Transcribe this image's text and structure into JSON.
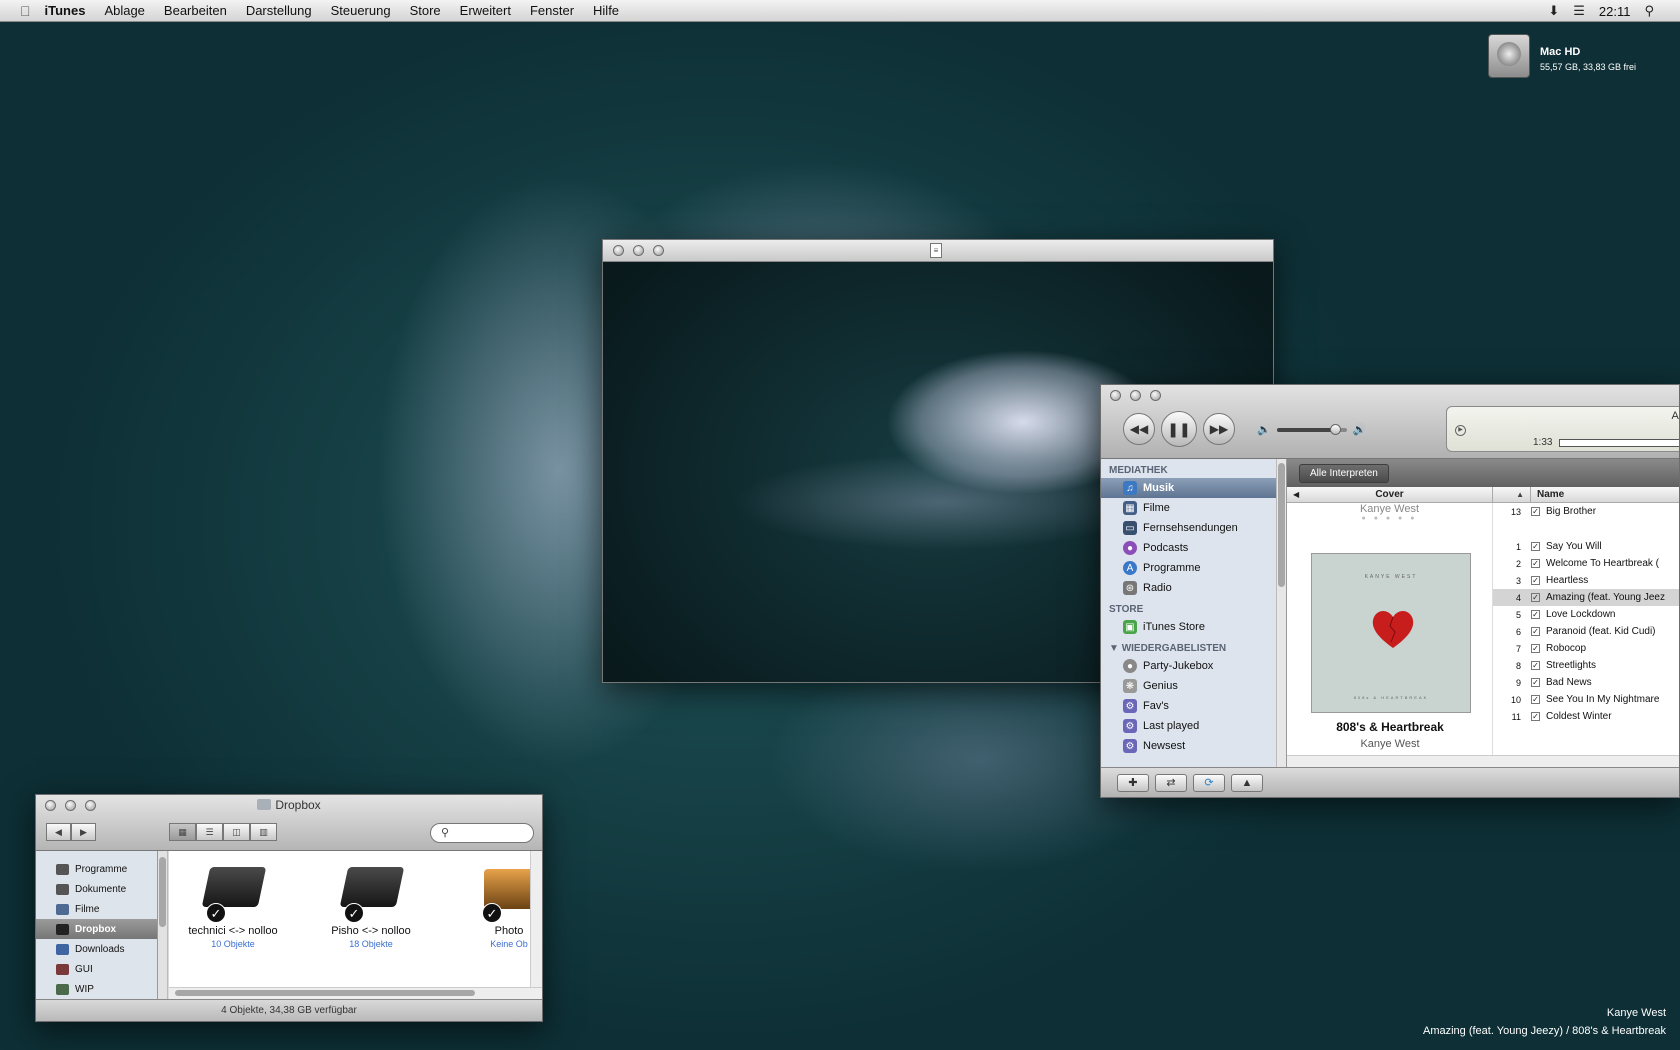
{
  "menubar": {
    "app": "iTunes",
    "items": [
      "Ablage",
      "Bearbeiten",
      "Darstellung",
      "Steuerung",
      "Store",
      "Erweitert",
      "Fenster",
      "Hilfe"
    ],
    "clock": "22:11"
  },
  "desktop": {
    "disk_name": "Mac HD",
    "disk_info": "55,57 GB, 33,83 GB frei",
    "nowplaying_artist": "Kanye West",
    "nowplaying_track": "Amazing (feat. Young Jeezy) / 808's & Heartbreak"
  },
  "itunes": {
    "lcd_title": "An",
    "lcd_time": "1:33",
    "volume_level": 0.85,
    "sidebar": {
      "library_head": "MEDIATHEK",
      "library": [
        "Musik",
        "Filme",
        "Fernsehsendungen",
        "Podcasts",
        "Programme",
        "Radio"
      ],
      "store_head": "STORE",
      "store": [
        "iTunes Store"
      ],
      "playlists_head": "WIEDERGABELISTEN",
      "playlists": [
        "Party-Jukebox",
        "Genius",
        "Fav's",
        "Last played",
        "Newsest"
      ]
    },
    "crumb": "Alle Interpreten",
    "columns": {
      "cover": "Cover",
      "name": "Name"
    },
    "prev_artist": "Kanye West",
    "prev_track": {
      "num": "13",
      "name": "Big Brother"
    },
    "album_title": "808's & Heartbreak",
    "album_artist": "Kanye West",
    "cover_art_top": "KANYE WEST",
    "cover_art_bottom": "808s & HEARTBREAK",
    "tracks": [
      {
        "num": "1",
        "name": "Say You Will"
      },
      {
        "num": "2",
        "name": "Welcome To Heartbreak ("
      },
      {
        "num": "3",
        "name": "Heartless"
      },
      {
        "num": "4",
        "name": "Amazing (feat. Young Jeez"
      },
      {
        "num": "5",
        "name": "Love Lockdown"
      },
      {
        "num": "6",
        "name": "Paranoid (feat. Kid Cudi)"
      },
      {
        "num": "7",
        "name": "Robocop"
      },
      {
        "num": "8",
        "name": "Streetlights"
      },
      {
        "num": "9",
        "name": "Bad News"
      },
      {
        "num": "10",
        "name": "See You In My Nightmare"
      },
      {
        "num": "11",
        "name": "Coldest Winter"
      }
    ]
  },
  "finder": {
    "title": "Dropbox",
    "sidebar": [
      "Programme",
      "Dokumente",
      "Filme",
      "Dropbox",
      "Downloads",
      "GUI",
      "WIP"
    ],
    "files": [
      {
        "name": "technici <-> nolloo",
        "sub": "10 Objekte"
      },
      {
        "name": "Pisho <-> nolloo",
        "sub": "18 Objekte"
      },
      {
        "name": "Photo",
        "sub": "Keine Ob"
      }
    ],
    "status": "4 Objekte, 34,38 GB verfügbar"
  },
  "colors": {
    "accent_blue": "#2f82c6",
    "sidebar_selection": "#5f7492",
    "desktop": "#0d2f35"
  }
}
